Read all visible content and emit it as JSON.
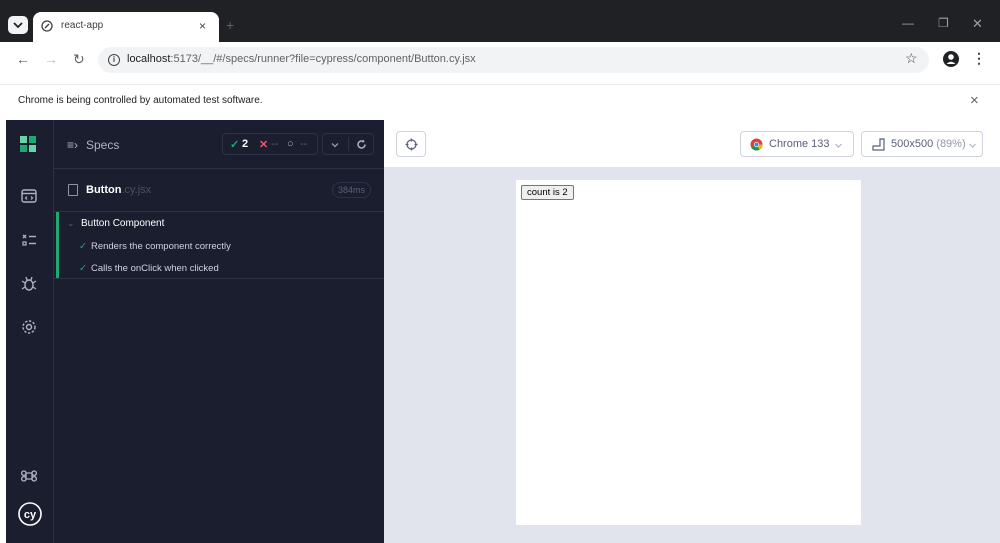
{
  "browser": {
    "tab_title": "react-app",
    "tab_close": "×",
    "new_tab": "+",
    "url_host": "localhost",
    "url_rest": ":5173/__/#/specs/runner?file=cypress/component/Button.cy.jsx",
    "infobar_text": "Chrome is being controlled by automated test software.",
    "infobar_close": "×"
  },
  "specs_panel": {
    "title": "Specs",
    "passed": "2",
    "failed": "--",
    "pending": "--",
    "file_name": "Button",
    "file_ext": ".cy.jsx",
    "duration": "384ms",
    "suite_title": "Button Component",
    "tests": [
      "Renders the component correctly",
      "Calls the onClick when clicked"
    ]
  },
  "runner": {
    "browser_label": "Chrome 133",
    "viewport_label": "500x500",
    "viewport_scale": "(89%)",
    "count_button": "count is 2"
  },
  "colors": {
    "pass": "#1fa971",
    "fail": "#f15372",
    "nav_bg": "#1b1e2e",
    "runner_bg": "#e1e3ed"
  }
}
